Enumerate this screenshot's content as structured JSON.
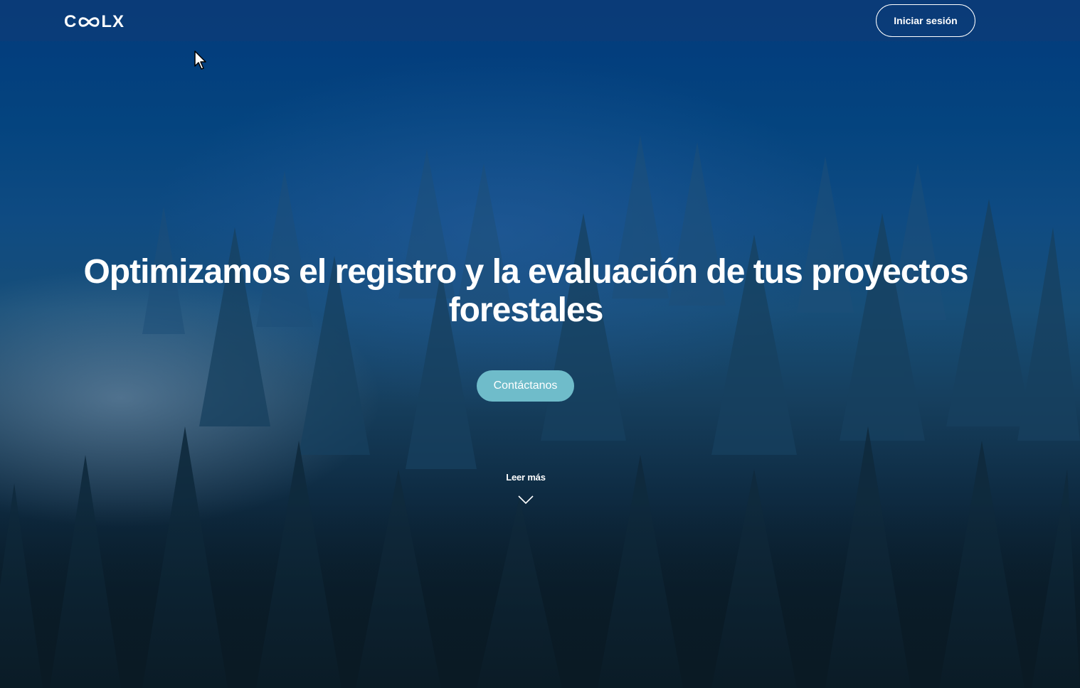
{
  "header": {
    "logo": {
      "text_start": "C",
      "text_end": "LX",
      "icon": "infinity-logo-icon"
    },
    "login_label": "Iniciar sesión"
  },
  "hero": {
    "title": "Optimizamos el registro y la evaluación de tus proyectos forestales",
    "cta_label": "Contáctanos",
    "read_more_label": "Leer más",
    "read_more_icon": "chevron-down-icon"
  },
  "colors": {
    "header_bg": "#0c3c78",
    "cta_bg": "#6fbcca",
    "text": "#ffffff"
  },
  "cursor_icon": "mouse-pointer-icon"
}
